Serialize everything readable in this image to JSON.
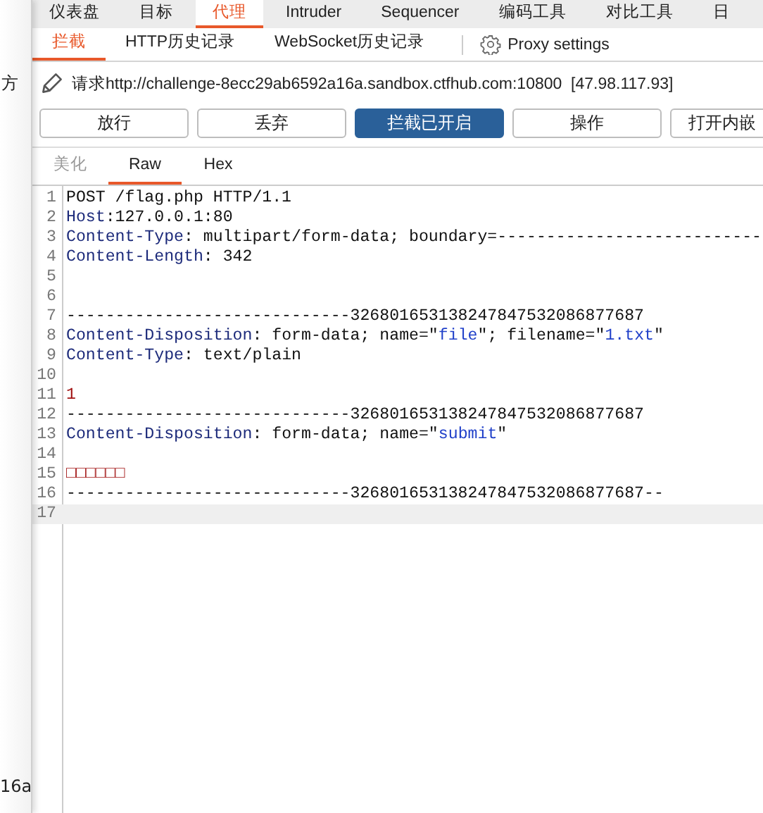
{
  "background_window": {
    "texts": [
      "方",
      "16a"
    ]
  },
  "main_tabs": [
    {
      "label": "仪表盘",
      "selected": false
    },
    {
      "label": "目标",
      "selected": false
    },
    {
      "label": "代理",
      "selected": true
    },
    {
      "label": "Intruder",
      "selected": false
    },
    {
      "label": "Sequencer",
      "selected": false
    },
    {
      "label": "编码工具",
      "selected": false
    },
    {
      "label": "对比工具",
      "selected": false
    },
    {
      "label": "日",
      "selected": false
    }
  ],
  "sub_tabs": [
    {
      "label": "拦截",
      "selected": true
    },
    {
      "label": "HTTP历史记录",
      "selected": false
    },
    {
      "label": "WebSocket历史记录",
      "selected": false
    }
  ],
  "proxy_settings": {
    "label": "Proxy settings"
  },
  "request_url": "请求http://challenge-8ecc29ab6592a16a.sandbox.ctfhub.com:10800  [47.98.117.93]",
  "buttons": [
    {
      "label": "放行",
      "selected": false
    },
    {
      "label": "丢弃",
      "selected": false
    },
    {
      "label": "拦截已开启",
      "selected": true
    },
    {
      "label": "操作",
      "selected": false
    },
    {
      "label": "打开内嵌",
      "selected": false
    }
  ],
  "editor_tabs": [
    {
      "label": "美化",
      "selected": false,
      "disabled": true
    },
    {
      "label": "Raw",
      "selected": true,
      "disabled": false
    },
    {
      "label": "Hex",
      "selected": false,
      "disabled": false
    }
  ],
  "lines": [
    {
      "number": "1",
      "current": false,
      "segments": [
        {
          "kind": "plain",
          "text": "POST /flag.php HTTP/1.1"
        }
      ]
    },
    {
      "number": "2",
      "current": false,
      "segments": [
        {
          "kind": "key",
          "text": "Host"
        },
        {
          "kind": "plain",
          "text": ":127.0.0.1:80"
        }
      ]
    },
    {
      "number": "3",
      "current": false,
      "segments": [
        {
          "kind": "key",
          "text": "Content-Type"
        },
        {
          "kind": "plain",
          "text": ": multipart/form-data; boundary=---------------------------"
        }
      ]
    },
    {
      "number": "4",
      "current": false,
      "segments": [
        {
          "kind": "key",
          "text": "Content-Length"
        },
        {
          "kind": "plain",
          "text": ": 342"
        }
      ]
    },
    {
      "number": "5",
      "current": false
    },
    {
      "number": "6",
      "current": false
    },
    {
      "number": "7",
      "current": false,
      "segments": [
        {
          "kind": "plain",
          "text": "-----------------------------326801653138247847532086877687"
        }
      ]
    },
    {
      "number": "8",
      "current": false,
      "segments": [
        {
          "kind": "key",
          "text": "Content-Disposition"
        },
        {
          "kind": "plain",
          "text": ": form-data; name=\""
        },
        {
          "kind": "string",
          "text": "file"
        },
        {
          "kind": "plain",
          "text": "\"; filename=\""
        },
        {
          "kind": "string",
          "text": "1.txt"
        },
        {
          "kind": "plain",
          "text": "\""
        }
      ]
    },
    {
      "number": "9",
      "current": false,
      "segments": [
        {
          "kind": "key",
          "text": "Content-Type"
        },
        {
          "kind": "plain",
          "text": ": text/plain"
        }
      ]
    },
    {
      "number": "10",
      "current": false
    },
    {
      "number": "11",
      "current": false,
      "segments": [
        {
          "kind": "body",
          "text": "1"
        }
      ]
    },
    {
      "number": "12",
      "current": false,
      "segments": [
        {
          "kind": "plain",
          "text": "-----------------------------326801653138247847532086877687"
        }
      ]
    },
    {
      "number": "13",
      "current": false,
      "segments": [
        {
          "kind": "key",
          "text": "Content-Disposition"
        },
        {
          "kind": "plain",
          "text": ": form-data; name=\""
        },
        {
          "kind": "string",
          "text": "submit"
        },
        {
          "kind": "plain",
          "text": "\""
        }
      ]
    },
    {
      "number": "14",
      "current": false
    },
    {
      "number": "15",
      "current": false,
      "segments": [
        {
          "kind": "body",
          "text": "□□□□□□"
        }
      ]
    },
    {
      "number": "16",
      "current": false,
      "segments": [
        {
          "kind": "plain",
          "text": "-----------------------------326801653138247847532086877687--"
        }
      ]
    },
    {
      "number": "17",
      "current": true
    }
  ]
}
